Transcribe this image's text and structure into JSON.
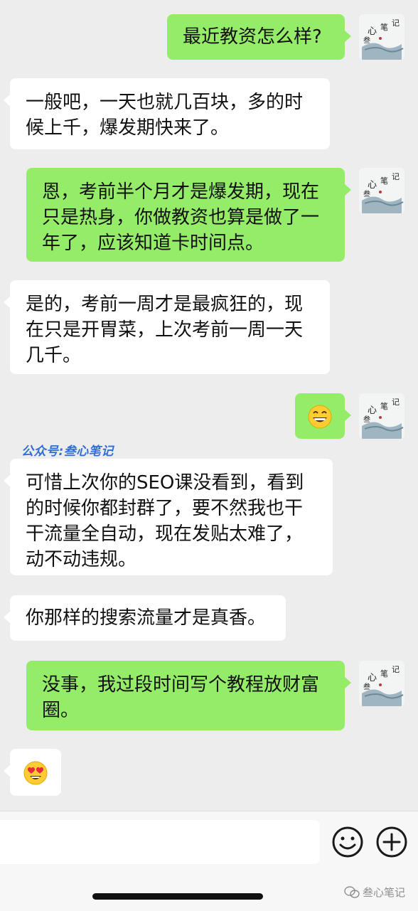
{
  "watermark": "公众号:叁心笔记",
  "messages": [
    {
      "dir": "out",
      "text": "最近教资怎么样?"
    },
    {
      "dir": "in",
      "text": "一般吧，一天也就几百块，多的时候上千，爆发期快来了。"
    },
    {
      "dir": "out",
      "text": "恩，考前半个月才是爆发期，现在只是热身，你做教资也算是做了一年了，应该知道卡时间点。"
    },
    {
      "dir": "in",
      "text": "是的，考前一周才是最疯狂的，现在只是开胃菜，上次考前一周一天几千。"
    },
    {
      "dir": "out",
      "emoji": "grin-icon"
    },
    {
      "dir": "in",
      "text": "可惜上次你的SEO课没看到，看到的时候你都封群了，要不然我也干干流量全自动，现在发贴太难了，动不动违规。"
    },
    {
      "dir": "in",
      "text": "你那样的搜索流量才是真香。"
    },
    {
      "dir": "out",
      "text": "没事，我过段时间写个教程放财富圈。"
    },
    {
      "dir": "in",
      "emoji": "heart-eyes-icon"
    }
  ],
  "avatar": {
    "label": "心 笔 记 叁"
  },
  "input": {
    "value": "",
    "placeholder": ""
  },
  "brand": "叁心笔记",
  "colors": {
    "out_bubble": "#95ec69",
    "in_bubble": "#ffffff",
    "background": "#ededed",
    "watermark": "#2f6fd6"
  }
}
